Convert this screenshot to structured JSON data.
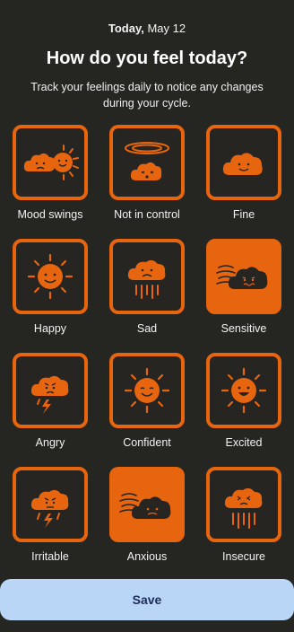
{
  "header": {
    "date_bold": "Today,",
    "date_rest": " May 12",
    "title": "How do you feel today?",
    "subtitle": "Track your feelings daily to notice any changes during your cycle."
  },
  "moods": [
    {
      "label": "Mood swings",
      "icon": "mood-swings-icon",
      "selected": false
    },
    {
      "label": "Not in control",
      "icon": "dizzy-cloud-icon",
      "selected": false
    },
    {
      "label": "Fine",
      "icon": "cloud-smile-icon",
      "selected": false
    },
    {
      "label": "Happy",
      "icon": "sun-smile-icon",
      "selected": false
    },
    {
      "label": "Sad",
      "icon": "rain-cloud-sad-icon",
      "selected": false
    },
    {
      "label": "Sensitive",
      "icon": "wind-cloud-icon",
      "selected": true
    },
    {
      "label": "Angry",
      "icon": "storm-cloud-angry-icon",
      "selected": false
    },
    {
      "label": "Confident",
      "icon": "sun-confident-icon",
      "selected": false
    },
    {
      "label": "Excited",
      "icon": "sun-excited-icon",
      "selected": false
    },
    {
      "label": "Irritable",
      "icon": "storm-cloud-irritable-icon",
      "selected": false
    },
    {
      "label": "Anxious",
      "icon": "wind-cloud-anxious-icon",
      "selected": true
    },
    {
      "label": "Insecure",
      "icon": "rain-cloud-insecure-icon",
      "selected": false
    }
  ],
  "save_label": "Save",
  "colors": {
    "background": "#252522",
    "accent": "#e8650f",
    "button": "#b9d6f6",
    "button_text": "#1d2d55"
  }
}
